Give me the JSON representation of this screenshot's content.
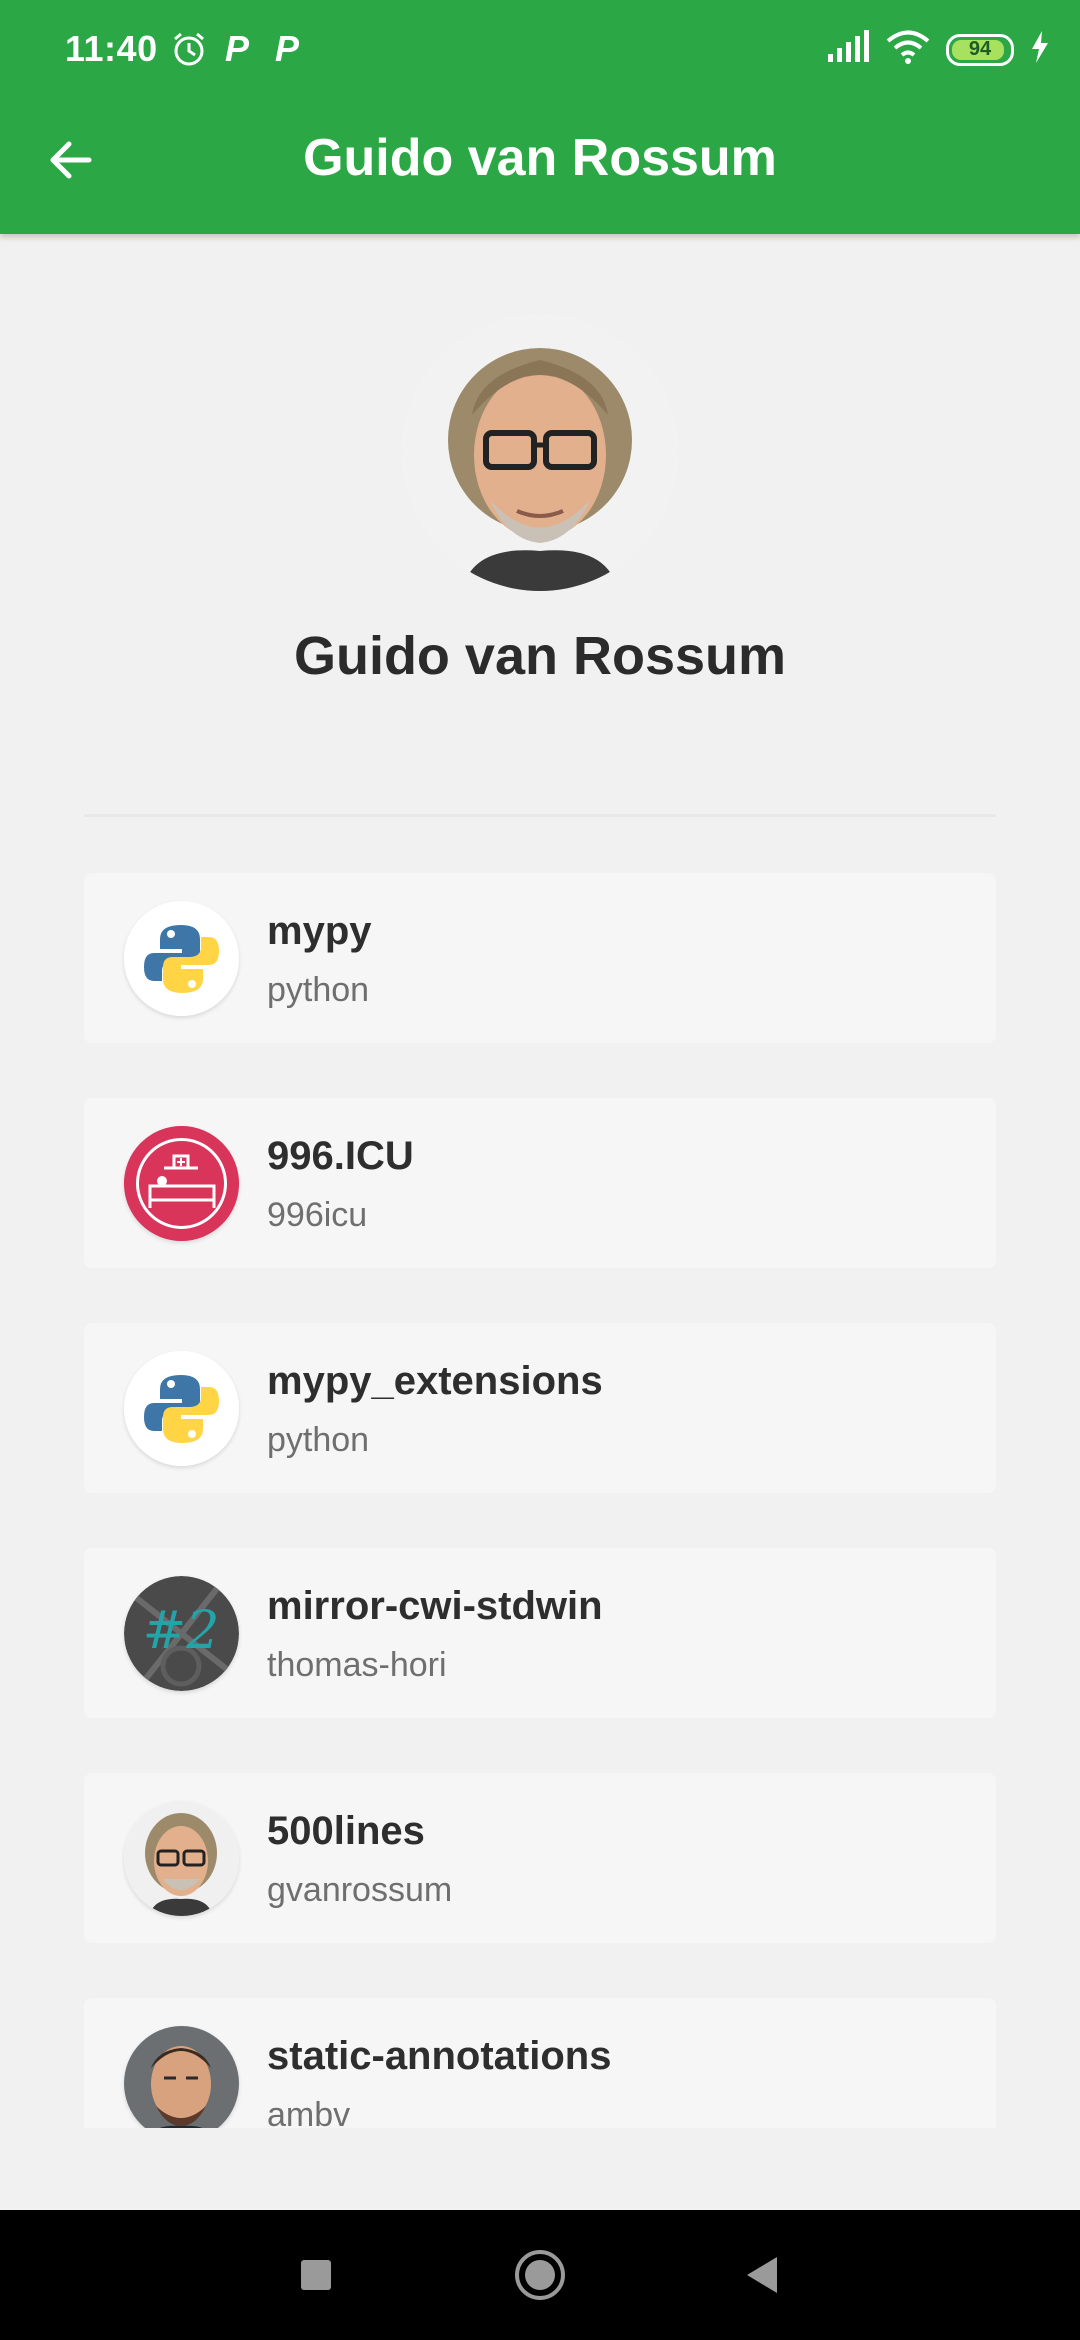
{
  "status_bar": {
    "time": "11:40",
    "battery": "94",
    "battery_level_percent": 94,
    "icons": [
      "alarm-icon",
      "parking-icon",
      "parking-icon",
      "signal-icon",
      "wifi-icon",
      "battery-icon",
      "charging-icon"
    ]
  },
  "toolbar": {
    "title": "Guido van Rossum",
    "back_icon": "arrow-left-icon"
  },
  "profile": {
    "name": "Guido van Rossum"
  },
  "repos": [
    {
      "name": "mypy",
      "owner": "python",
      "avatar": "python-logo"
    },
    {
      "name": "996.ICU",
      "owner": "996icu",
      "avatar": "996icu-logo"
    },
    {
      "name": "mypy_extensions",
      "owner": "python",
      "avatar": "python-logo"
    },
    {
      "name": "mirror-cwi-stdwin",
      "owner": "thomas-hori",
      "avatar": "number-2-logo"
    },
    {
      "name": "500lines",
      "owner": "gvanrossum",
      "avatar": "person-avatar"
    },
    {
      "name": "static-annotations",
      "owner": "ambv",
      "avatar": "person-avatar"
    }
  ],
  "nav": {
    "recents": "square-icon",
    "home": "circle-icon",
    "back": "triangle-icon"
  },
  "colors": {
    "primary": "#2ba745",
    "background": "#f1f1f1",
    "card": "#f6f6f6",
    "accent_996": "#d9345a"
  }
}
